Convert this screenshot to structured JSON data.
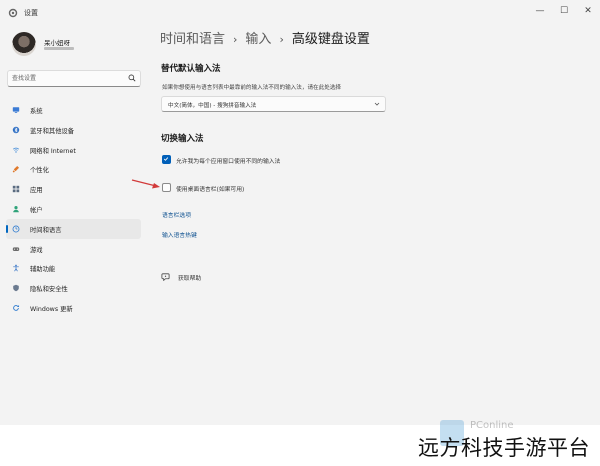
{
  "window": {
    "title": "设置",
    "controls": {
      "minimize": "—",
      "maximize": "☐",
      "close": "✕"
    }
  },
  "sidebar": {
    "user_name": "呆小妞呀",
    "search_placeholder": "查找设置",
    "items": [
      {
        "label": "系统",
        "icon": "monitor-icon",
        "color": "#3a7bd5"
      },
      {
        "label": "蓝牙和其他设备",
        "icon": "bluetooth-icon",
        "color": "#2f6fc4"
      },
      {
        "label": "网络和 Internet",
        "icon": "wifi-icon",
        "color": "#4a90d9"
      },
      {
        "label": "个性化",
        "icon": "brush-icon",
        "color": "#e0792b"
      },
      {
        "label": "应用",
        "icon": "apps-icon",
        "color": "#5a6b80"
      },
      {
        "label": "帐户",
        "icon": "account-icon",
        "color": "#2fa37a"
      },
      {
        "label": "时间和语言",
        "icon": "globe-clock-icon",
        "color": "#2e7bcf",
        "active": true
      },
      {
        "label": "游戏",
        "icon": "gamepad-icon",
        "color": "#6b6b6b"
      },
      {
        "label": "辅助功能",
        "icon": "accessibility-icon",
        "color": "#2f6fc4"
      },
      {
        "label": "隐私和安全性",
        "icon": "shield-icon",
        "color": "#6b7a8f"
      },
      {
        "label": "Windows 更新",
        "icon": "update-icon",
        "color": "#2e7bcf"
      }
    ]
  },
  "breadcrumb": {
    "items": [
      "时间和语言",
      "输入",
      "高级键盘设置"
    ],
    "separator": "›"
  },
  "override_section": {
    "title": "替代默认输入法",
    "description": "如果你想使用与语言列表中最靠前的输入法不同的输入法，请在此处选择",
    "dropdown_value": "中文(简体，中国) - 搜狗拼音输入法"
  },
  "switch_section": {
    "title": "切换输入法",
    "checkbox1_label": "允许我为每个应用窗口使用不同的输入法",
    "checkbox1_checked": true,
    "checkbox2_label": "使用桌面语言栏(如果可用)",
    "checkbox2_checked": false,
    "link_language_bar": "语言栏选项",
    "link_hotkeys": "输入语言热键"
  },
  "help": {
    "label": "获取帮助"
  },
  "watermark": {
    "text": "PConline"
  },
  "footer": {
    "brand": "远方科技手游平台"
  },
  "colors": {
    "accent": "#005fb8",
    "annotation_arrow": "#d23a3a",
    "sidebar_active": "#e8e8e8"
  }
}
